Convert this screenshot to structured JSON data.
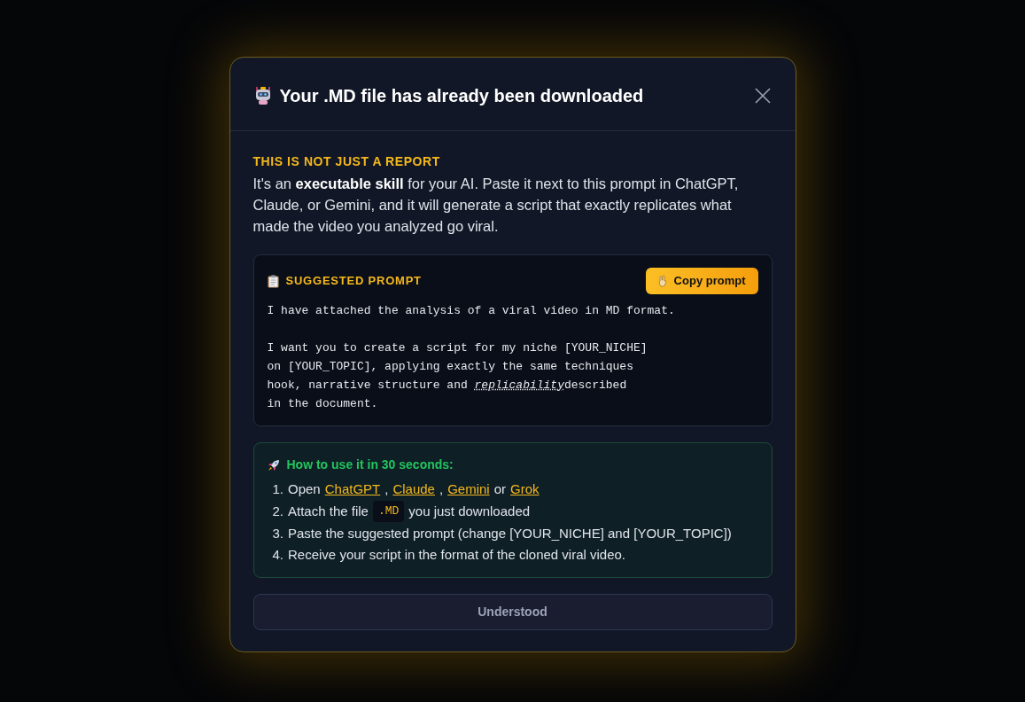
{
  "dialog": {
    "title": "Your .MD file has already been downloaded",
    "eyebrow": "THIS IS NOT JUST A REPORT",
    "intro": "It's an **executable skill** for your AI. Paste it next to this prompt in ChatGPT, Claude, or Gemini, and it will generate a script that exactly replicates what made the video you analyzed go viral.",
    "prompt_card": {
      "label": "SUGGESTED PROMPT",
      "copy_button": "Copy prompt",
      "paragraphs": [
        [
          {
            "kind": "text",
            "text": "I have attached the analysis of a viral video in MD format."
          }
        ],
        [
          {
            "kind": "text",
            "text": "I want you to create a script for my niche [YOUR_NICHE]\non [YOUR_TOPIC], applying exactly the same techniques\nhook, narrative structure and "
          },
          {
            "kind": "em",
            "text": "replicability"
          },
          {
            "kind": "text",
            "text": "described\nin the document."
          }
        ]
      ]
    },
    "howto": {
      "title": "How to use it in 30 seconds:",
      "steps": [
        {
          "number": "1.",
          "parts": [
            {
              "kind": "text",
              "text": "Open"
            },
            {
              "kind": "link",
              "text": "ChatGPT"
            },
            {
              "kind": "text",
              "text": ","
            },
            {
              "kind": "link",
              "text": "Claude"
            },
            {
              "kind": "text",
              "text": ","
            },
            {
              "kind": "link",
              "text": "Gemini"
            },
            {
              "kind": "text",
              "text": "or"
            },
            {
              "kind": "link",
              "text": "Grok"
            }
          ]
        },
        {
          "number": "2.",
          "parts": [
            {
              "kind": "text",
              "text": "Attach the file"
            },
            {
              "kind": "code",
              "text": ".MD"
            },
            {
              "kind": "text",
              "text": "you just downloaded"
            }
          ]
        },
        {
          "number": "3.",
          "parts": [
            {
              "kind": "text",
              "text": "Paste the suggested prompt (change [YOUR_NICHE] and [YOUR_TOPIC])"
            }
          ]
        },
        {
          "number": "4.",
          "parts": [
            {
              "kind": "text",
              "text": "Receive your script in the format of the cloned viral video."
            }
          ]
        }
      ]
    },
    "confirm_button": "Understood"
  }
}
